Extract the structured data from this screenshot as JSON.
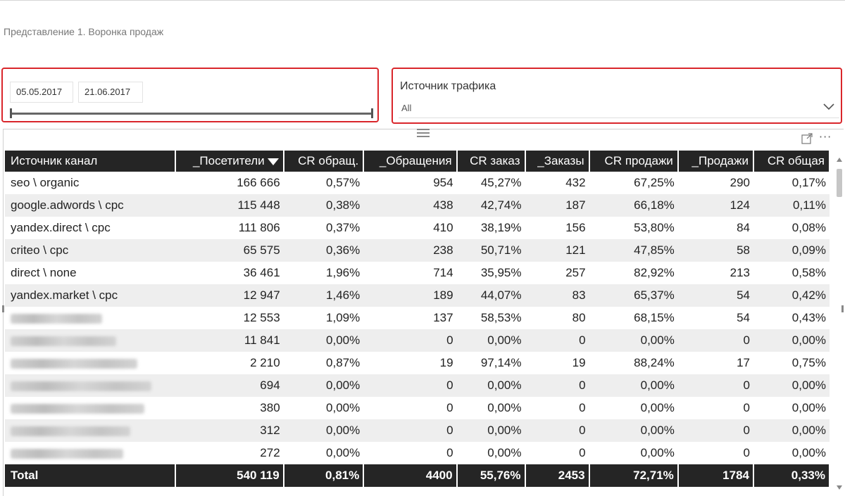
{
  "page": {
    "title": "Представление 1. Воронка продаж"
  },
  "date_slicer": {
    "start": "05.05.2017",
    "end": "21.06.2017"
  },
  "source_slicer": {
    "title": "Источник трафика",
    "selected": "All"
  },
  "table": {
    "columns": [
      "Источник канал",
      "_Посетители",
      "CR обращ.",
      "_Обращения",
      "CR заказ",
      "_Заказы",
      "CR продажи",
      "_Продажи",
      "CR общая"
    ],
    "sorted_column": "_Посетители",
    "rows": [
      [
        "seo \\ organic",
        "166 666",
        "0,57%",
        "954",
        "45,27%",
        "432",
        "67,25%",
        "290",
        "0,17%"
      ],
      [
        "google.adwords \\ cpc",
        "115 448",
        "0,38%",
        "438",
        "42,74%",
        "187",
        "66,18%",
        "124",
        "0,11%"
      ],
      [
        "yandex.direct \\ cpc",
        "111 806",
        "0,37%",
        "410",
        "38,19%",
        "156",
        "53,80%",
        "84",
        "0,08%"
      ],
      [
        "criteo \\ cpc",
        "65 575",
        "0,36%",
        "238",
        "50,71%",
        "121",
        "47,85%",
        "58",
        "0,09%"
      ],
      [
        "direct \\ none",
        "36 461",
        "1,96%",
        "714",
        "35,95%",
        "257",
        "82,92%",
        "213",
        "0,58%"
      ],
      [
        "yandex.market \\ cpc",
        "12 947",
        "1,46%",
        "189",
        "44,07%",
        "83",
        "65,37%",
        "54",
        "0,42%"
      ],
      [
        "",
        "12 553",
        "1,09%",
        "137",
        "58,53%",
        "80",
        "68,15%",
        "54",
        "0,43%"
      ],
      [
        "",
        "11 841",
        "0,00%",
        "0",
        "0,00%",
        "0",
        "0,00%",
        "0",
        "0,00%"
      ],
      [
        "",
        "2 210",
        "0,87%",
        "19",
        "97,14%",
        "19",
        "88,24%",
        "17",
        "0,75%"
      ],
      [
        "",
        "694",
        "0,00%",
        "0",
        "0,00%",
        "0",
        "0,00%",
        "0",
        "0,00%"
      ],
      [
        "",
        "380",
        "0,00%",
        "0",
        "0,00%",
        "0",
        "0,00%",
        "0",
        "0,00%"
      ],
      [
        "",
        "312",
        "0,00%",
        "0",
        "0,00%",
        "0",
        "0,00%",
        "0",
        "0,00%"
      ],
      [
        "",
        "272",
        "0,00%",
        "0",
        "0,00%",
        "0",
        "0,00%",
        "0",
        "0,00%"
      ]
    ],
    "total": [
      "Total",
      "540 119",
      "0,81%",
      "4400",
      "55,76%",
      "2453",
      "72,71%",
      "1784",
      "0,33%"
    ]
  },
  "colors": {
    "highlight_border": "#d9262b",
    "header_bg": "#252525",
    "stripe_bg": "#eeeeee"
  },
  "icons": [
    "chevron-down-icon",
    "drag-grip-icon",
    "focus-mode-icon",
    "more-options-icon",
    "sort-descending-icon"
  ]
}
